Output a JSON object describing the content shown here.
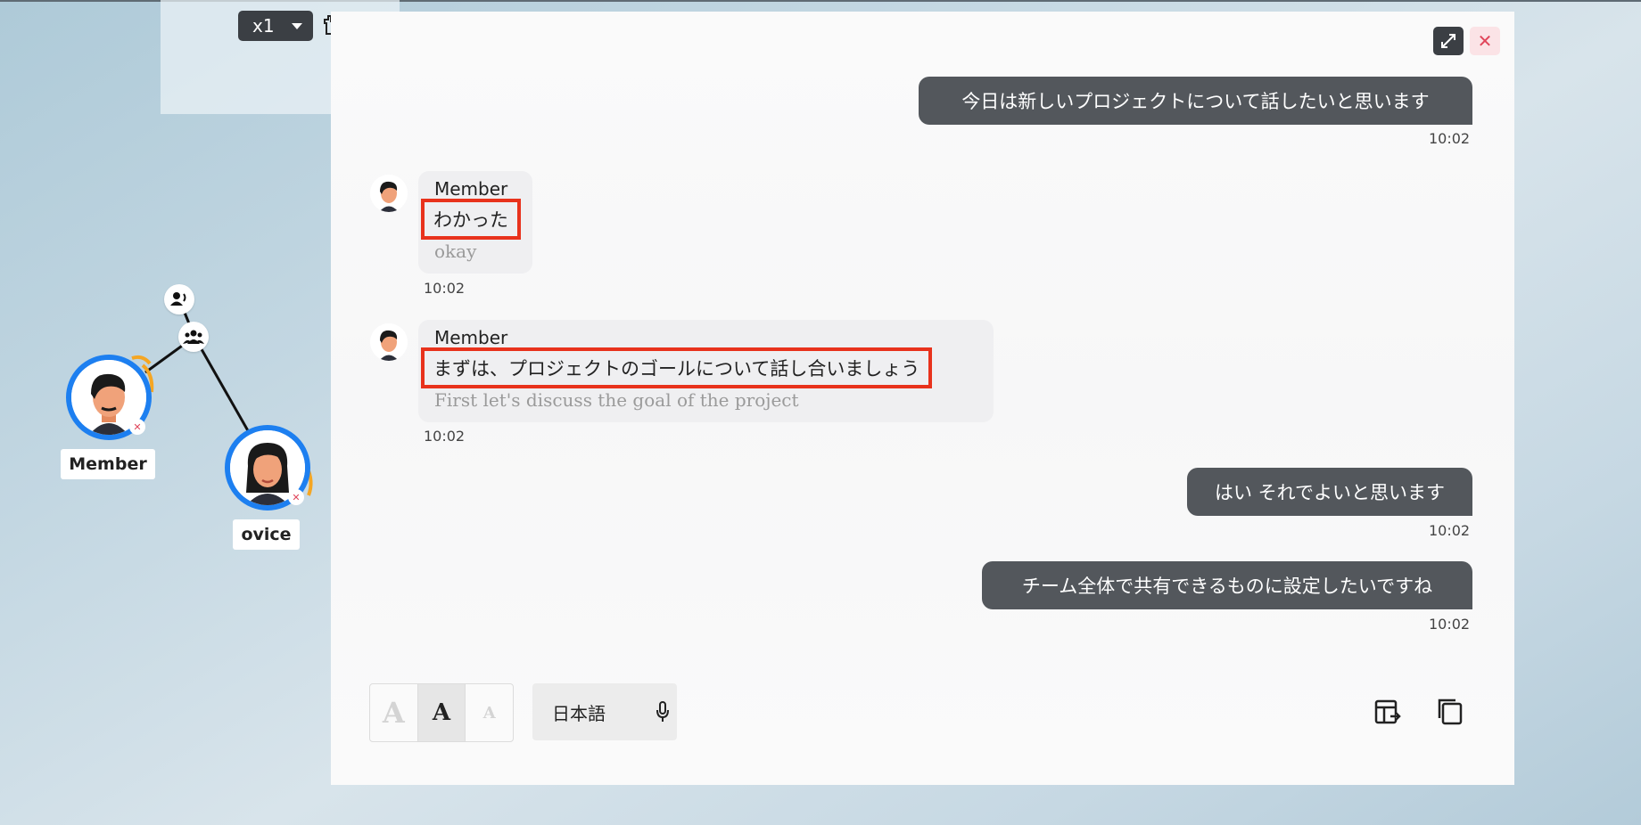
{
  "toolbar": {
    "zoom_value": "x1",
    "close_glyph": "✕"
  },
  "chat": {
    "messages": [
      {
        "from": "me",
        "text": "今日は新しいプロジェクトについて話したいと思います",
        "time": "10:02"
      },
      {
        "from": "other",
        "sender": "Member",
        "original": "わかった",
        "translation": "okay",
        "time": "10:02"
      },
      {
        "from": "other",
        "sender": "Member",
        "original": "まずは、プロジェクトのゴールについて話し合いましょう",
        "translation": "First let's discuss the goal of the project",
        "time": "10:02"
      },
      {
        "from": "me",
        "text": "はい それでよいと思います",
        "time": "10:02"
      },
      {
        "from": "me",
        "text": "チーム全体で共有できるものに設定したいですね",
        "time": "10:02"
      }
    ],
    "close_glyph": "✕"
  },
  "controls": {
    "font_sizes": [
      "A",
      "A",
      "A"
    ],
    "active_font_index": 1,
    "language": "日本語"
  },
  "map": {
    "users": [
      {
        "name": "Member"
      },
      {
        "name": "ovice"
      }
    ]
  },
  "colors": {
    "accent_blue": "#1d7ff0",
    "highlight_red": "#e8321c",
    "my_bubble": "#53575c",
    "close_red": "#e0455a"
  },
  "icons": [
    "expand-icon",
    "close-icon",
    "microphone-icon",
    "table-export-icon",
    "copy-icon",
    "hand-icon",
    "speaker-group-icon",
    "group-icon",
    "mic-muted-icon"
  ]
}
